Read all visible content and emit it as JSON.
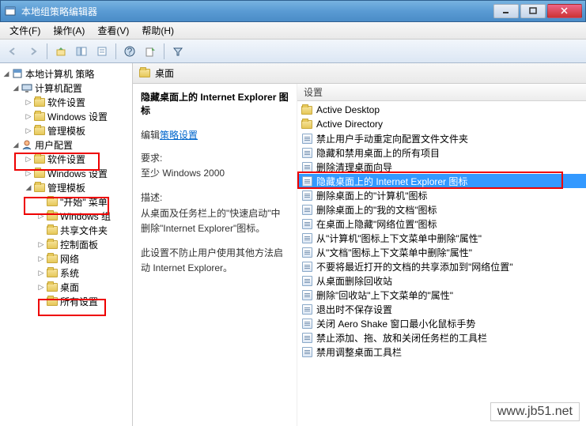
{
  "window": {
    "title": "本地组策略编辑器"
  },
  "menu": {
    "file": "文件(F)",
    "action": "操作(A)",
    "view": "查看(V)",
    "help": "帮助(H)"
  },
  "tree": {
    "root": "本地计算机 策略",
    "computer_config": "计算机配置",
    "cc_software": "软件设置",
    "cc_windows": "Windows 设置",
    "cc_admin": "管理模板",
    "user_config": "用户配置",
    "uc_software": "软件设置",
    "uc_windows": "Windows 设置",
    "uc_admin": "管理模板",
    "start_menu": "\"开始\" 菜单",
    "windows_comp": "Windows 组",
    "shared_folders": "共享文件夹",
    "control_panel": "控制面板",
    "network": "网络",
    "system": "系统",
    "desktop": "桌面",
    "all_settings": "所有设置"
  },
  "content": {
    "header": "桌面",
    "detail_title": "隐藏桌面上的 Internet Explorer 图标",
    "edit_label": "编辑",
    "edit_link": "策略设置",
    "req_label": "要求:",
    "req_value": "至少 Windows 2000",
    "desc_label": "描述:",
    "desc_line1": "从桌面及任务栏上的\"快速启动\"中删除\"Internet Explorer\"图标。",
    "desc_line2": "此设置不防止用户使用其他方法启动 Internet Explorer。"
  },
  "list": {
    "header": "设置"
  },
  "items": [
    {
      "type": "folder",
      "label": "Active Desktop"
    },
    {
      "type": "folder",
      "label": "Active Directory"
    },
    {
      "type": "setting",
      "label": "禁止用户手动重定向配置文件文件夹"
    },
    {
      "type": "setting",
      "label": "隐藏和禁用桌面上的所有项目"
    },
    {
      "type": "setting",
      "label": "删除清理桌面向导"
    },
    {
      "type": "setting",
      "label": "隐藏桌面上的 Internet Explorer 图标",
      "selected": true
    },
    {
      "type": "setting",
      "label": "删除桌面上的\"计算机\"图标"
    },
    {
      "type": "setting",
      "label": "删除桌面上的\"我的文档\"图标"
    },
    {
      "type": "setting",
      "label": "在桌面上隐藏\"网络位置\"图标"
    },
    {
      "type": "setting",
      "label": "从\"计算机\"图标上下文菜单中删除\"属性\""
    },
    {
      "type": "setting",
      "label": "从\"文档\"图标上下文菜单中删除\"属性\""
    },
    {
      "type": "setting",
      "label": "不要将最近打开的文档的共享添加到\"网络位置\""
    },
    {
      "type": "setting",
      "label": "从桌面删除回收站"
    },
    {
      "type": "setting",
      "label": "删除\"回收站\"上下文菜单的\"属性\""
    },
    {
      "type": "setting",
      "label": "退出时不保存设置"
    },
    {
      "type": "setting",
      "label": "关闭 Aero Shake 窗口最小化鼠标手势"
    },
    {
      "type": "setting",
      "label": "禁止添加、拖、放和关闭任务栏的工具栏"
    },
    {
      "type": "setting",
      "label": "禁用调整桌面工具栏"
    }
  ],
  "watermark": "www.jb51.net"
}
